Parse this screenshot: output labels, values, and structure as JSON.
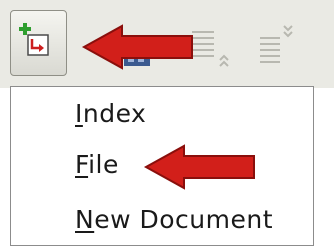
{
  "toolbar": {
    "insert_index_button": {
      "icon": "insert-index-icon",
      "has_dropdown": true
    },
    "disabled_icons": [
      "hide-subpoints-icon",
      "show-subpoints-icon"
    ]
  },
  "menu": {
    "items": [
      {
        "mnemonic": "I",
        "rest": "ndex"
      },
      {
        "mnemonic": "F",
        "rest": "ile"
      },
      {
        "mnemonic": "N",
        "rest": "ew Document"
      }
    ]
  },
  "annotations": {
    "arrow_color": "#d21f1a",
    "arrow_targets": [
      "insert-index-button",
      "menu-item-file"
    ]
  },
  "colors": {
    "toolbar_bg": "#eaeae4",
    "menu_border": "#8c8c8c",
    "text": "#1a1a1a"
  }
}
